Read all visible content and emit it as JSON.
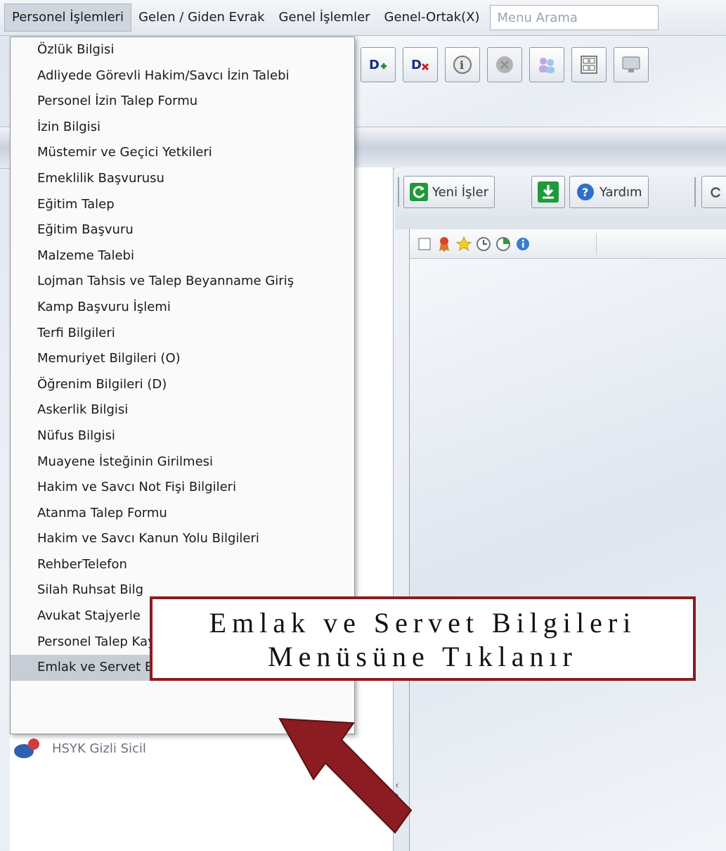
{
  "menubar": {
    "items": [
      "Personel İşlemleri",
      "Gelen / Giden Evrak",
      "Genel İşlemler",
      "Genel-Ortak(X)"
    ],
    "search_placeholder": "Menu Arama"
  },
  "toolbar2": {
    "refresh_label": "Yeni İşler",
    "help_label": "Yardım"
  },
  "dropdown": {
    "items": [
      "Özlük Bilgisi",
      "Adliyede Görevli Hakim/Savcı İzin Talebi",
      "Personel İzin Talep Formu",
      "İzin Bilgisi",
      "Müstemir ve Geçici Yetkileri",
      "Emeklilik Başvurusu",
      "Eğitim Talep",
      "Eğitim Başvuru",
      "Malzeme Talebi",
      "Lojman Tahsis ve Talep Beyanname Giriş",
      "Kamp Başvuru İşlemi",
      "Terfi Bilgileri",
      "Memuriyet Bilgileri (O)",
      "Öğrenim Bilgileri (D)",
      "Askerlik Bilgisi",
      "Nüfus Bilgisi",
      "Muayene İsteğinin Girilmesi",
      "Hakim ve Savcı Not Fişi Bilgileri",
      "Atanma Talep Formu",
      "Hakim ve Savcı Kanun Yolu Bilgileri",
      "RehberTelefon",
      "Silah Ruhsat Bilg",
      "Avukat Stajyerle",
      "Personel Talep Kayıt",
      "Emlak ve Servet Bilgileri (Yeni)"
    ]
  },
  "leftpanel": {
    "hsyk_label": "HSYK Gizli Sicil"
  },
  "callout": {
    "line1": "Emlak ve Servet Bilgileri",
    "line2": "Menüsüne Tıklanır"
  },
  "colors": {
    "callout_border": "#8a1c22",
    "arrow": "#8a1c22",
    "selected_bg": "#c7cdd4"
  }
}
